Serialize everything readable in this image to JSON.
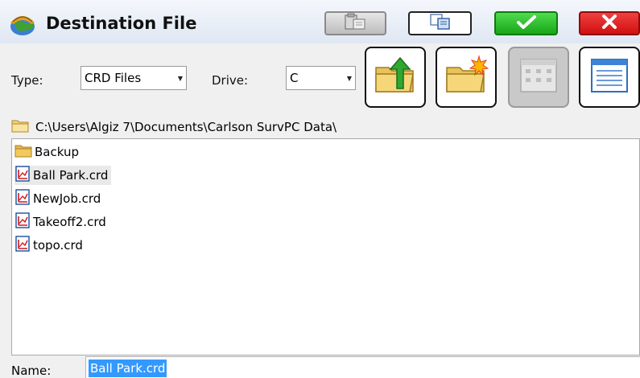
{
  "titlebar": {
    "app_icon": "globe-icon",
    "title": "Destination File",
    "buttons": [
      {
        "name": "paste-button",
        "icon": "paste-icon"
      },
      {
        "name": "copy-button",
        "icon": "copy-icon"
      },
      {
        "name": "ok-button",
        "icon": "check-icon"
      },
      {
        "name": "cancel-button",
        "icon": "close-icon"
      }
    ]
  },
  "filters": {
    "type_label": "Type:",
    "type_value": "CRD Files",
    "drive_label": "Drive:",
    "drive_value": "C"
  },
  "toolbar": [
    {
      "name": "up-folder-button",
      "icon": "folder-up-icon"
    },
    {
      "name": "new-folder-button",
      "icon": "new-folder-icon"
    },
    {
      "name": "icon-view-button",
      "icon": "icon-view-icon",
      "disabled": true
    },
    {
      "name": "list-view-button",
      "icon": "list-view-icon"
    }
  ],
  "path": "C:\\Users\\Algiz 7\\Documents\\Carlson SurvPC Data\\",
  "files": [
    {
      "label": "Backup",
      "kind": "folder"
    },
    {
      "label": "Ball Park.crd",
      "kind": "crd",
      "selected": true
    },
    {
      "label": "NewJob.crd",
      "kind": "crd"
    },
    {
      "label": "Takeoff2.crd",
      "kind": "crd"
    },
    {
      "label": "topo.crd",
      "kind": "crd"
    }
  ],
  "name_field": {
    "label": "Name:",
    "value": "Ball Park.crd"
  },
  "colors": {
    "ok_green": "#22b422",
    "cancel_red": "#e01e1e",
    "selection_blue": "#3399ff"
  }
}
